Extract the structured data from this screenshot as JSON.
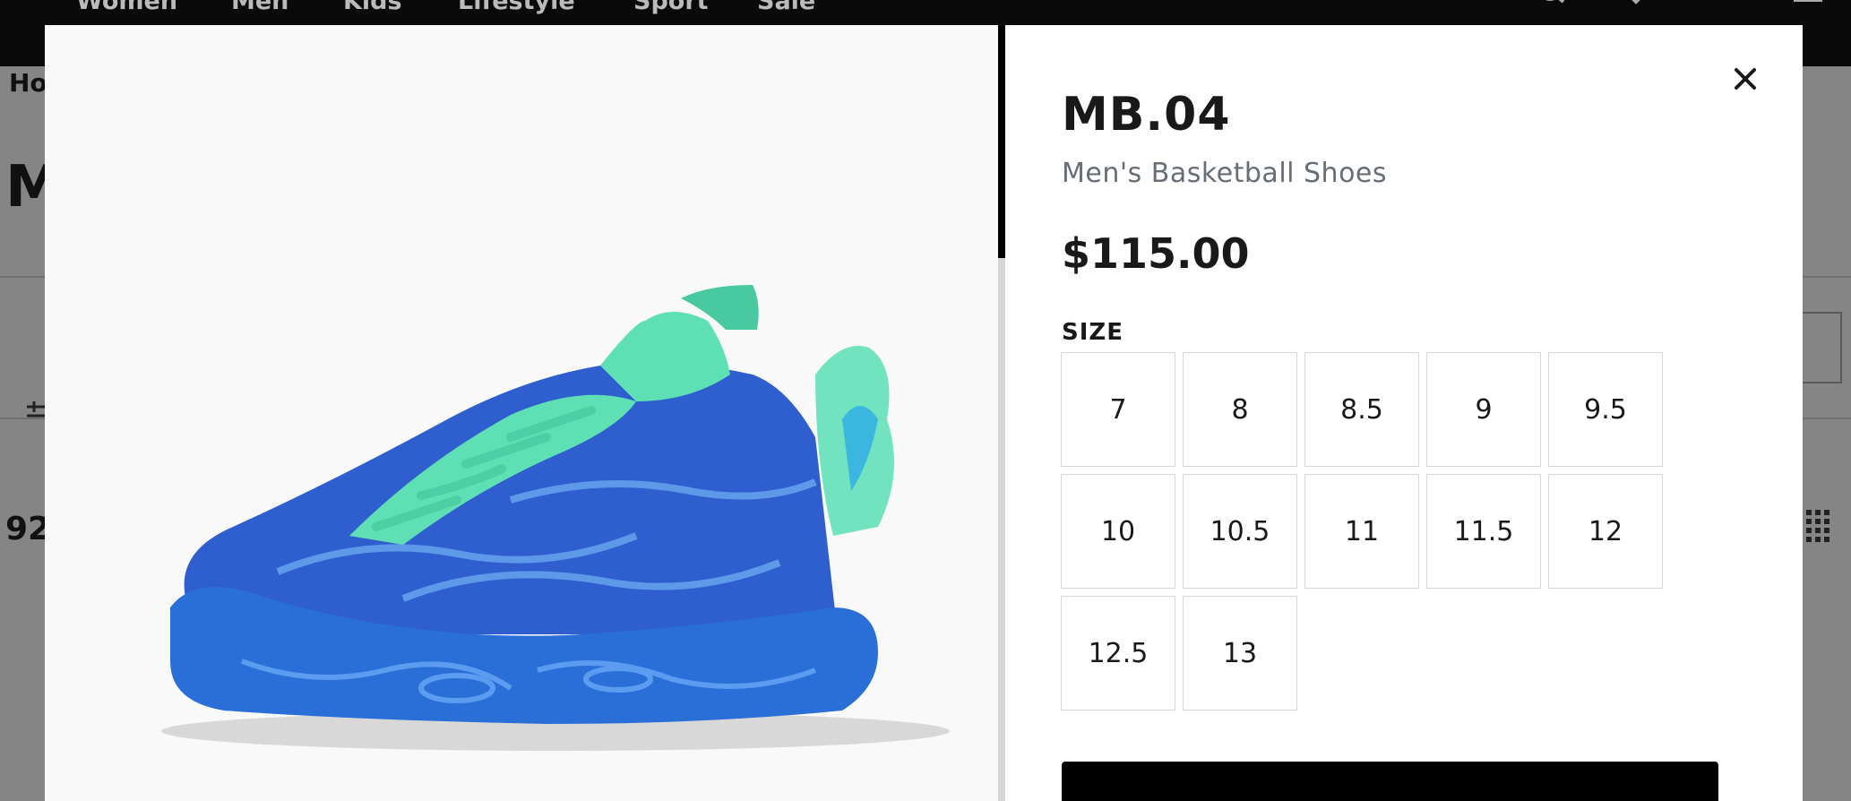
{
  "background_page": {
    "nav_links": [
      "Women",
      "Men",
      "Kids",
      "Lifestyle",
      "Sport",
      "Sale"
    ],
    "breadcrumb_partial": "Ho",
    "heading_partial": "M",
    "count_partial": "92"
  },
  "modal": {
    "product_name": "MB.04",
    "product_subtitle": "Men's Basketball Shoes",
    "price": "$115.00",
    "size_label": "SIZE",
    "sizes": [
      "7",
      "8",
      "8.5",
      "9",
      "9.5",
      "10",
      "10.5",
      "11",
      "11.5",
      "12",
      "12.5",
      "13"
    ],
    "close_icon": "close-icon"
  },
  "colors": {
    "shoe_upper": "#2f5fcf",
    "shoe_sole": "#2a6fd8",
    "shoe_accent": "#5fe0b4",
    "modal_text": "#191919",
    "subtitle_text": "#676d75"
  }
}
